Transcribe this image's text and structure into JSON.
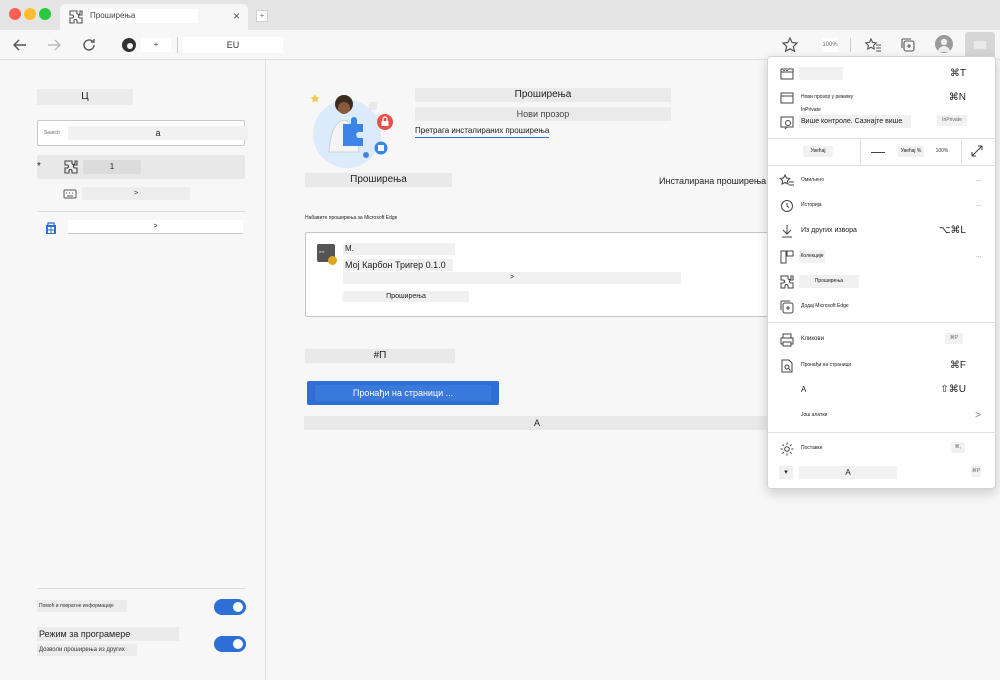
{
  "tab": {
    "title": "Проширења",
    "close": "×",
    "new_tab": "+"
  },
  "toolbar": {
    "address_chip": "+",
    "url": "EU",
    "zoom_chip": "100%"
  },
  "sidebar": {
    "title": "Ц",
    "search": {
      "chip": "Search",
      "value": "a"
    },
    "extensions_item": {
      "marker": "*",
      "label": "1"
    },
    "keyboard_item": {
      "label": ">"
    },
    "store_item": {
      "label": ">"
    },
    "help_label": "Помоћ и повратне информације",
    "dev_mode_label": "Режим за програмере",
    "allow_other_label": "Дозволи проширења из других"
  },
  "main": {
    "title": "Проширења",
    "new_window": "Нови прозор",
    "search_link": "Претрага инсталираних проширења",
    "extensions_heading": "Проширења",
    "installed_label": "Инсталирана проширења",
    "store_note": "Набавите проширења за Microsoft Edge",
    "card": {
      "icon_chip": "ext",
      "name": "M.",
      "version": "Мој Карбон Тригер 0.1.0",
      "description": ">",
      "details": "Проширења"
    },
    "shortcut_heading": "#П",
    "find_button": "Пронађи на страници ...",
    "after_label": "A"
  },
  "menu": {
    "items": [
      {
        "label": "",
        "shortcut": "⌘T"
      },
      {
        "label": "Нови прозор у режиму InPrivate",
        "shortcut": "⌘N"
      },
      {
        "label": "Више контроле. Сазнајте више",
        "shortcut": ""
      },
      {
        "label": "Омиљено",
        "shortcut": ""
      },
      {
        "label": "Историја",
        "shortcut": ""
      },
      {
        "label": "Из других извора",
        "shortcut": "⌥⌘L"
      },
      {
        "label": "Колекције",
        "shortcut": ""
      },
      {
        "label": "Проширења",
        "shortcut": ""
      },
      {
        "label": "Додај Microsoft Edge",
        "shortcut": ""
      },
      {
        "label": "Кликови",
        "shortcut": ""
      },
      {
        "label": "Пронађи на страници",
        "shortcut": "⌘F"
      },
      {
        "label": "A",
        "shortcut": "⇧⌘U"
      },
      {
        "label": "Још алатки",
        "shortcut": ">"
      },
      {
        "label": "Поставке",
        "shortcut": ""
      },
      {
        "label": "A",
        "shortcut": ""
      }
    ],
    "item3_chip": "InPrivate",
    "zoom_label": "Увећај",
    "zoom_minus": "—",
    "zoom_value": "Увећај %",
    "zoom_plus": "100%",
    "print_chip": "⌘P",
    "more_chip": "⌘P",
    "settings_chip": "⌘,",
    "dots": "..."
  },
  "colors": {
    "accent": "#2d6fd4",
    "badge": "#e0a526"
  }
}
